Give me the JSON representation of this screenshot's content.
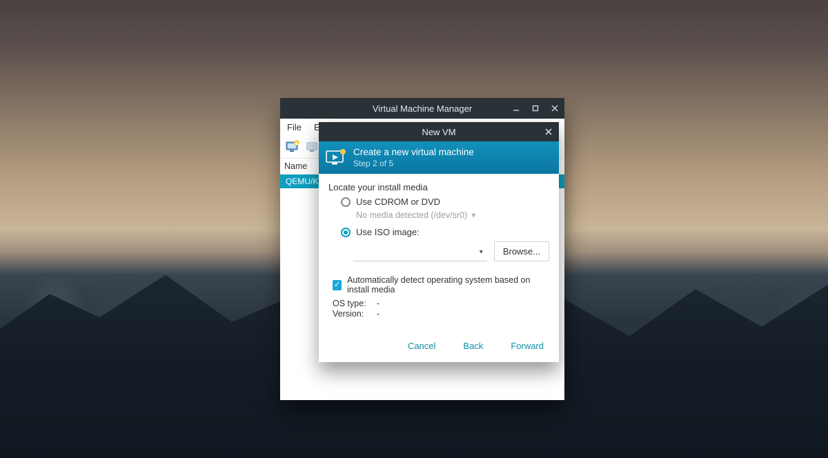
{
  "main_window": {
    "title": "Virtual Machine Manager",
    "menu": {
      "file": "File",
      "edit": "Edit"
    },
    "columns": {
      "name": "Name"
    },
    "rows": [
      {
        "label": "QEMU/KVM"
      }
    ]
  },
  "dialog": {
    "title": "New VM",
    "header": {
      "title": "Create a new virtual machine",
      "step": "Step 2 of 5"
    },
    "section_label": "Locate your install media",
    "option_cd": "Use CDROM or DVD",
    "cd_detected": "No media detected (/dev/sr0)",
    "option_iso": "Use ISO image:",
    "browse": "Browse...",
    "auto_detect": "Automatically detect operating system based on install media",
    "os_type_label": "OS type:",
    "os_type_value": "-",
    "version_label": "Version:",
    "version_value": "-",
    "buttons": {
      "cancel": "Cancel",
      "back": "Back",
      "forward": "Forward"
    }
  }
}
